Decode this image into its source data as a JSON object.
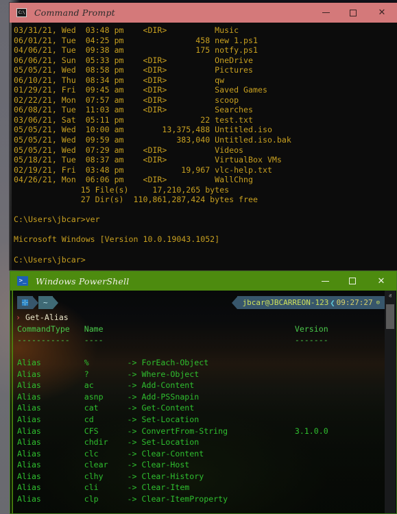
{
  "cmd_window": {
    "title": "Command Prompt",
    "icon": "cmd-icon",
    "controls": {
      "minimize": "–",
      "maximize": "□",
      "close": "✕"
    },
    "lines": [
      "03/31/21, Wed  03:48 pm    <DIR>          Music",
      "06/01/21, Tue  04:25 pm               458 new 1.ps1",
      "04/06/21, Tue  09:38 am               175 notfy.ps1",
      "06/06/21, Sun  05:33 pm    <DIR>          OneDrive",
      "05/05/21, Wed  08:58 pm    <DIR>          Pictures",
      "06/10/21, Thu  08:34 pm    <DIR>          qw",
      "01/29/21, Fri  09:45 am    <DIR>          Saved Games",
      "02/22/21, Mon  07:57 am    <DIR>          scoop",
      "06/08/21, Tue  11:03 am    <DIR>          Searches",
      "03/06/21, Sat  05:11 pm                22 test.txt",
      "05/05/21, Wed  10:00 am        13,375,488 Untitled.iso",
      "05/05/21, Wed  09:59 am           383,040 Untitled.iso.bak",
      "05/05/21, Wed  07:29 am    <DIR>          Videos",
      "05/18/21, Tue  08:37 am    <DIR>          VirtualBox VMs",
      "02/19/21, Fri  03:48 pm            19,967 vlc-help.txt",
      "04/26/21, Mon  06:06 pm    <DIR>          WallChng",
      "              15 File(s)     17,210,265 bytes",
      "              27 Dir(s)  110,861,287,424 bytes free",
      "",
      "C:\\Users\\jbcar>ver",
      "",
      "Microsoft Windows [Version 10.0.19043.1052]",
      "",
      "C:\\Users\\jbcar>"
    ]
  },
  "ps_window": {
    "title": "Windows PowerShell",
    "icon": "powershell-icon",
    "controls": {
      "minimize": "–",
      "maximize": "□",
      "close": "✕"
    },
    "prompt": {
      "left_segment_icon": "windows-logo-icon",
      "path_segment": "~",
      "right_user_host": "jbcar@JBCARREON-123",
      "right_separator": "❮",
      "right_time": "09:27:27",
      "clock_icon": "⊙",
      "caret": "›",
      "command": "Get-Alias"
    },
    "table": {
      "headers": [
        "CommandType",
        "Name",
        "Version"
      ],
      "rules": [
        "-----------",
        "----",
        "-------"
      ],
      "rows": [
        {
          "type": "Alias",
          "name": "%        -> ForEach-Object",
          "version": ""
        },
        {
          "type": "Alias",
          "name": "?        -> Where-Object",
          "version": ""
        },
        {
          "type": "Alias",
          "name": "ac       -> Add-Content",
          "version": ""
        },
        {
          "type": "Alias",
          "name": "asnp     -> Add-PSSnapin",
          "version": ""
        },
        {
          "type": "Alias",
          "name": "cat      -> Get-Content",
          "version": ""
        },
        {
          "type": "Alias",
          "name": "cd       -> Set-Location",
          "version": ""
        },
        {
          "type": "Alias",
          "name": "CFS      -> ConvertFrom-String",
          "version": "3.1.0.0"
        },
        {
          "type": "Alias",
          "name": "chdir    -> Set-Location",
          "version": ""
        },
        {
          "type": "Alias",
          "name": "clc      -> Clear-Content",
          "version": ""
        },
        {
          "type": "Alias",
          "name": "clear    -> Clear-Host",
          "version": ""
        },
        {
          "type": "Alias",
          "name": "clhy     -> Clear-History",
          "version": ""
        },
        {
          "type": "Alias",
          "name": "cli      -> Clear-Item",
          "version": ""
        },
        {
          "type": "Alias",
          "name": "clp      -> Clear-ItemProperty",
          "version": ""
        }
      ]
    },
    "scrollbar": {
      "up": "ⱏ",
      "down": "ⱟ"
    }
  },
  "colors": {
    "cmd_titlebar": "#d4797a",
    "cmd_text": "#c8a020",
    "cmd_background": "#0c0c0c",
    "ps_titlebar": "#4d8b0f",
    "ps_text": "#2fbf2f",
    "ps_border": "#3f7a1e",
    "prompt_blue": "#37566b",
    "prompt_cyan": "#3f6a75",
    "prompt_yellow": "#cfe25c",
    "caret_red": "#d9534f"
  }
}
